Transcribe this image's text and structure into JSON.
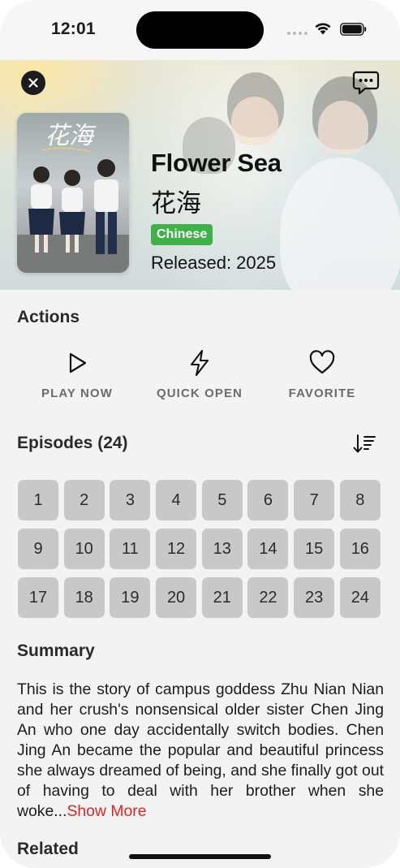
{
  "status_bar": {
    "time": "12:01"
  },
  "hero": {
    "title_en": "Flower Sea",
    "title_zh": "花海",
    "language_badge": "Chinese",
    "released": "Released: 2025",
    "poster_title": "花海",
    "close_icon": "close-icon",
    "chat_icon": "chat-bubble-icon"
  },
  "actions": {
    "heading": "Actions",
    "items": [
      {
        "label": "PLAY NOW",
        "icon": "play-icon"
      },
      {
        "label": "QUICK OPEN",
        "icon": "lightning-icon"
      },
      {
        "label": "FAVORITE",
        "icon": "heart-icon"
      }
    ]
  },
  "episodes": {
    "heading": "Episodes (24)",
    "sort_icon": "sort-icon",
    "items": [
      "1",
      "2",
      "3",
      "4",
      "5",
      "6",
      "7",
      "8",
      "9",
      "10",
      "11",
      "12",
      "13",
      "14",
      "15",
      "16",
      "17",
      "18",
      "19",
      "20",
      "21",
      "22",
      "23",
      "24"
    ]
  },
  "summary": {
    "heading": "Summary",
    "text": "This is the story of campus goddess Zhu Nian Nian and her crush's nonsensical older sister Chen Jing An who one day accidentally switch bodies. Chen Jing An became the popular and beautiful princess she always dreamed of being, and she finally got out of having to deal with her brother when she woke...",
    "show_more": "Show More"
  },
  "related": {
    "heading": "Related"
  },
  "colors": {
    "accent_red": "#e02424",
    "badge_green": "#3fb04a",
    "episode_tile": "#c8c8c8"
  }
}
